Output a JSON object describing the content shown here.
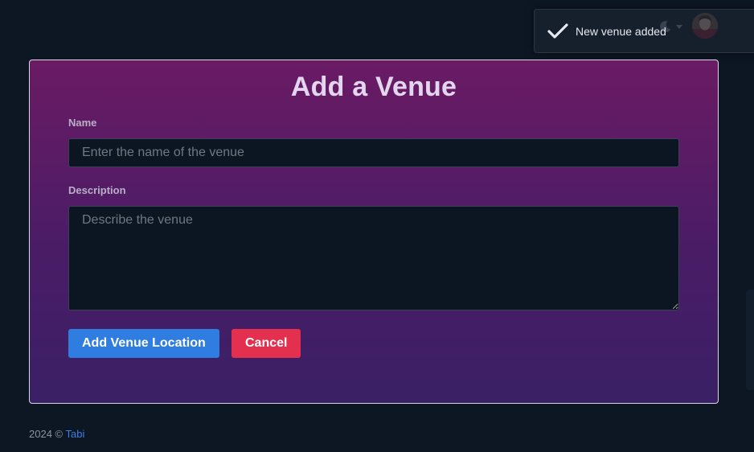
{
  "toast": {
    "message": "New venue added",
    "icon": "check-icon"
  },
  "navbar": {
    "theme_icon": "moon-icon",
    "menu_icon": "chevron-down-icon",
    "avatar_icon": "user-avatar"
  },
  "form": {
    "title": "Add a Venue",
    "name": {
      "label": "Name",
      "placeholder": "Enter the name of the venue",
      "value": ""
    },
    "description": {
      "label": "Description",
      "placeholder": "Describe the venue",
      "value": ""
    },
    "submit_label": "Add Venue Location",
    "cancel_label": "Cancel"
  },
  "footer": {
    "copyright": "2024 ©",
    "brand": "Tabi"
  },
  "colors": {
    "background": "#0d1623",
    "card_gradient_top": "#6a1b64",
    "card_gradient_bottom": "#3a2066",
    "primary": "#2f7de0",
    "danger": "#e3304f",
    "link": "#3f7ee8"
  }
}
